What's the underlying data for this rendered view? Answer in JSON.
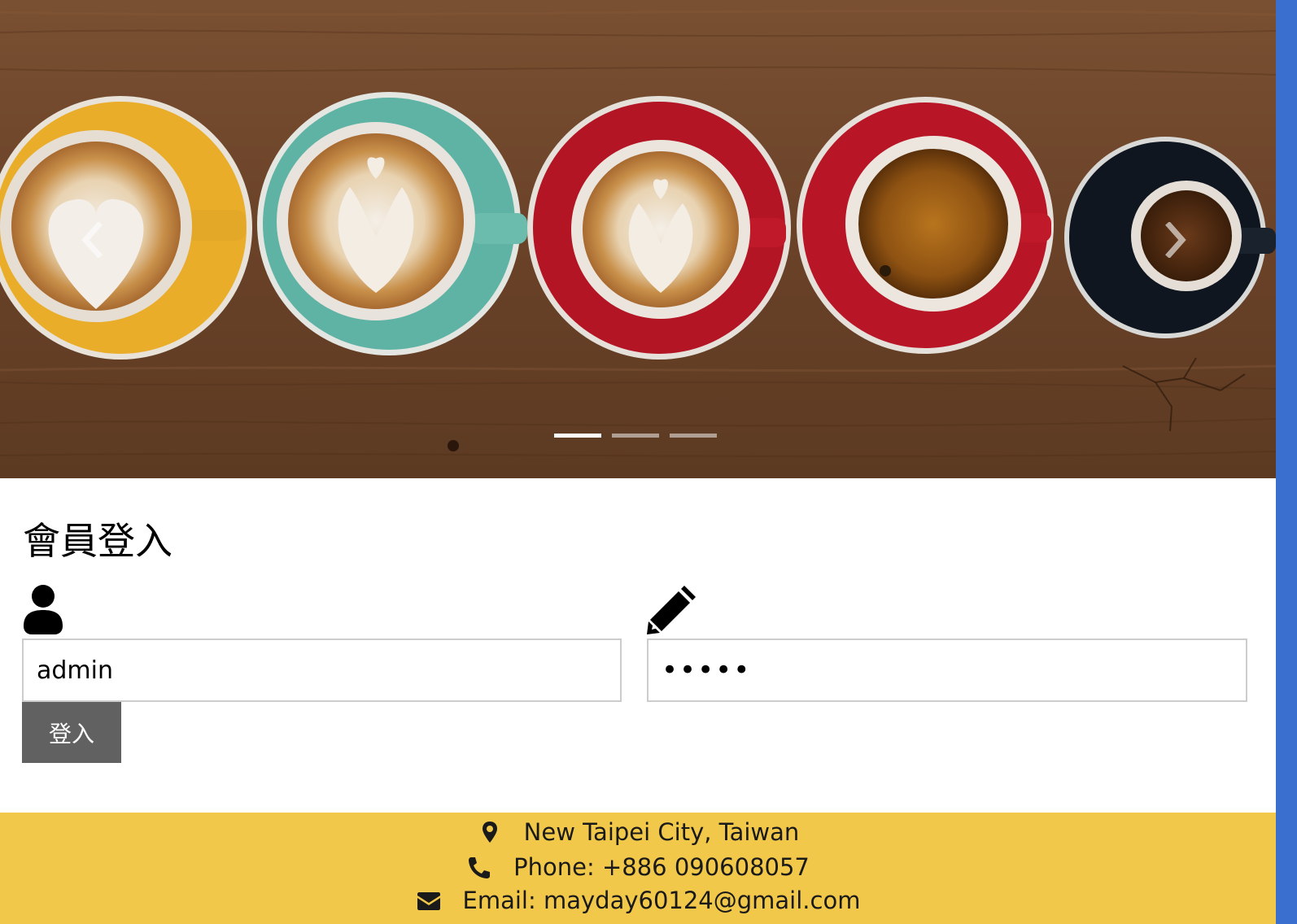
{
  "carousel": {
    "image_alt": "Five coffee cups on a wooden table",
    "prev_label": "‹",
    "next_label": "›",
    "indicators": [
      {
        "active": true
      },
      {
        "active": false
      },
      {
        "active": false
      }
    ]
  },
  "login": {
    "title": "會員登入",
    "username": {
      "icon": "user-icon",
      "value": "admin"
    },
    "password": {
      "icon": "pencil-icon",
      "value": "•••••"
    },
    "submit_label": "登入"
  },
  "footer": {
    "background": "#f2c84b",
    "location_icon": "map-marker-icon",
    "location": "New Taipei City, Taiwan",
    "phone_icon": "phone-icon",
    "phone": "Phone: +886 090608057",
    "email_icon": "envelope-icon",
    "email": "Email: mayday60124@gmail.com"
  }
}
